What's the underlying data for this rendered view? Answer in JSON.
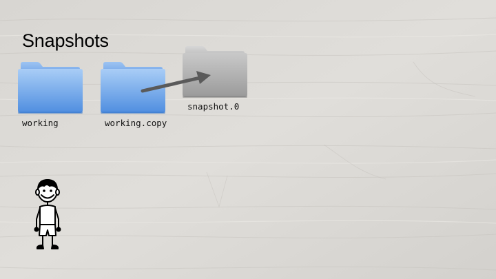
{
  "slide": {
    "title": "Snapshots"
  },
  "folders": [
    {
      "name": "working",
      "color": "blue"
    },
    {
      "name": "working.copy",
      "color": "blue"
    },
    {
      "name": "snapshot.0",
      "color": "gray"
    }
  ],
  "colors": {
    "folder_blue_top": "#a9cdf6",
    "folder_blue_bottom": "#4f8ee0",
    "folder_gray_top": "#c9c9c9",
    "folder_gray_bottom": "#9a9a9a",
    "arrow": "#5a5a5a",
    "background": "#dcdad6"
  },
  "icons": {
    "arrow": "copy-arrow-icon",
    "person": "stick-figure-person-icon",
    "folder": "folder-icon"
  }
}
